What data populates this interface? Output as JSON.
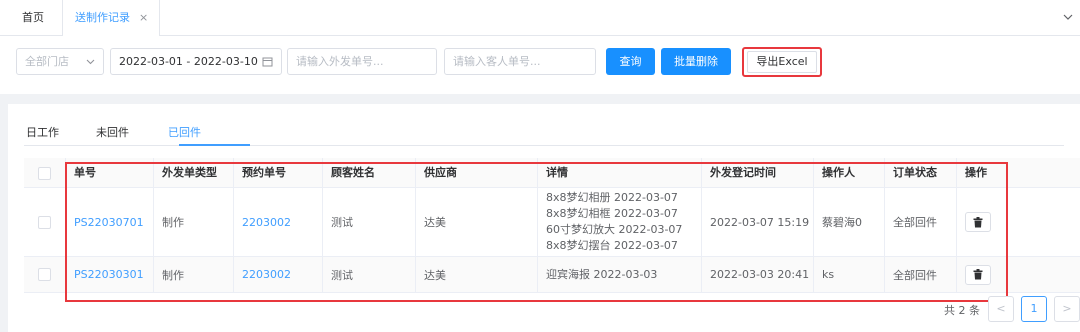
{
  "tabs": {
    "home": "首页",
    "active": "送制作记录",
    "close": "×"
  },
  "filter": {
    "store_select": "全部门店",
    "date_range": "2022-03-01 - 2022-03-10",
    "ext_no_placeholder": "请输入外发单号...",
    "customer_no_placeholder": "请输入客人单号...",
    "query_btn": "查询",
    "batch_delete_btn": "批量删除",
    "export_btn": "导出Excel"
  },
  "subtabs": [
    "日工作",
    "未回件",
    "已回件"
  ],
  "table": {
    "headers": [
      "单号",
      "外发单类型",
      "预约单号",
      "顾客姓名",
      "供应商",
      "详情",
      "外发登记时间",
      "操作人",
      "订单状态",
      "操作"
    ],
    "rows": [
      {
        "order_no": "PS22030701",
        "type": "制作",
        "booking_no": "2203002",
        "customer": "测试",
        "supplier": "达美",
        "details": [
          "8x8梦幻相册 2022-03-07",
          "8x8梦幻相框 2022-03-07",
          "60寸梦幻放大 2022-03-07",
          "8x8梦幻摆台 2022-03-07"
        ],
        "time": "2022-03-07 15:19",
        "operator": "蔡碧海0",
        "status": "全部回件"
      },
      {
        "order_no": "PS22030301",
        "type": "制作",
        "booking_no": "2203002",
        "customer": "测试",
        "supplier": "达美",
        "details": [
          "迎宾海报 2022-03-03"
        ],
        "time": "2022-03-03 20:41",
        "operator": "ks",
        "status": "全部回件"
      }
    ]
  },
  "pagination": {
    "total": "共 2 条",
    "page": "1",
    "prev": "<",
    "next": ">"
  },
  "colors": {
    "primary": "#1890ff",
    "link": "#409eff",
    "highlight": "#e8383d"
  }
}
